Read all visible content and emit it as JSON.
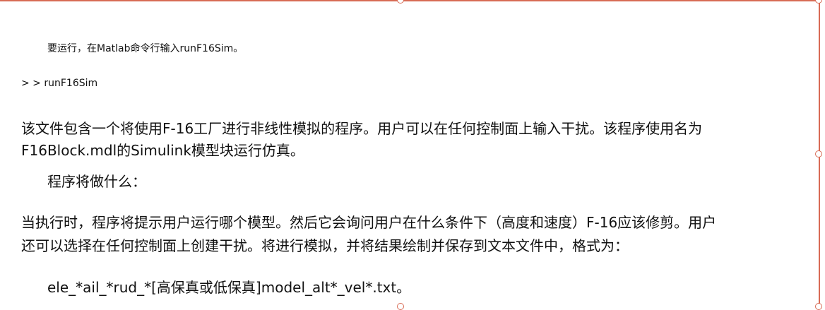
{
  "document": {
    "run_instruction": "要运行，在Matlab命令行输入runF16Sim。",
    "command_line": "> > runF16Sim",
    "description_line1": "该文件包含一个将使用F-16工厂进行非线性模拟的程序。用户可以在任何控制面上输入干扰。该程序使用名为",
    "description_line2": "F16Block.mdl的Simulink模型块运行仿真。",
    "section_heading": "程序将做什么：",
    "behavior_line1": "当执行时，程序将提示用户运行哪个模型。然后它会询问用户在什么条件下（高度和速度）F-16应该修剪。用户",
    "behavior_line2": "还可以选择在任何控制面上创建干扰。将进行模拟，并将结果绘制并保存到文本文件中，格式为：",
    "filename_format": "ele_*ail_*rud_*[高保真或低保真]model_alt*_vel*.txt。"
  },
  "colors": {
    "selection_frame": "#d86b55",
    "text": "#111111"
  }
}
